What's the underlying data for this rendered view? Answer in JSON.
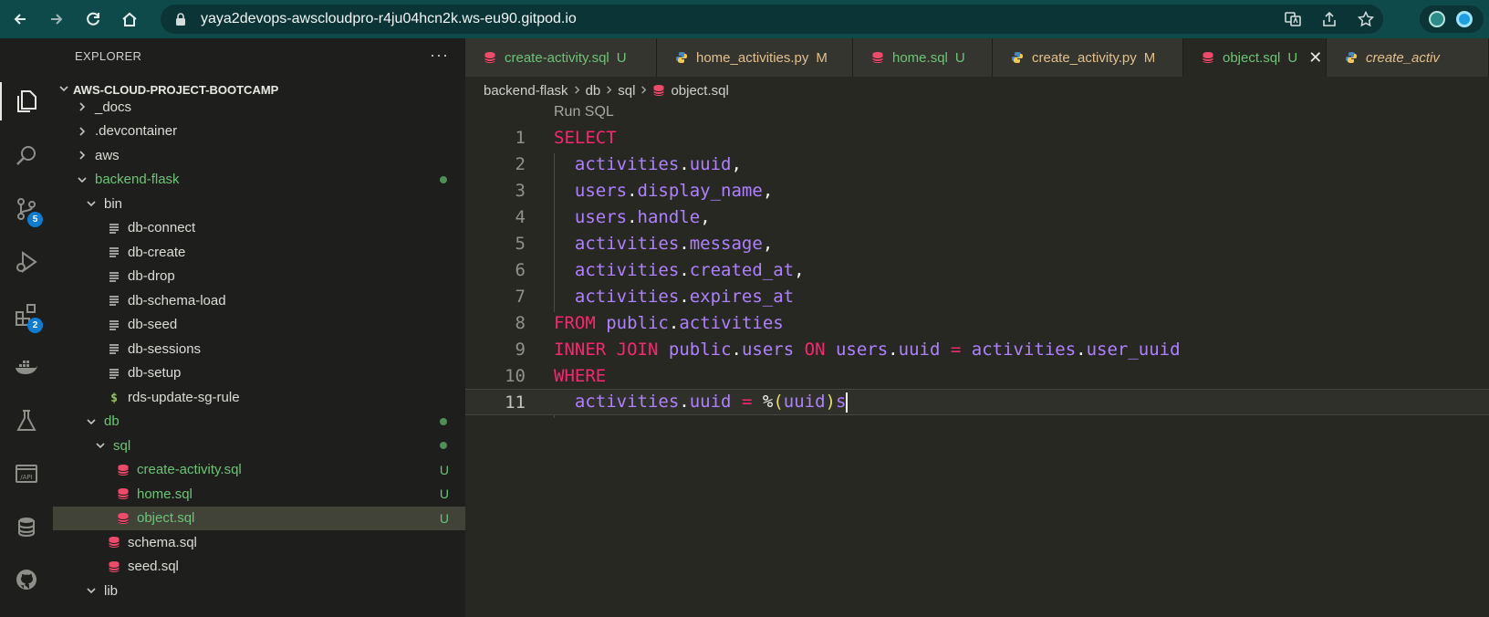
{
  "browser": {
    "url": "yaya2devops-awscloudpro-r4ju04hcn2k.ws-eu90.gitpod.io"
  },
  "activity_bar": {
    "items": [
      {
        "icon": "explorer-icon",
        "active": true
      },
      {
        "icon": "search-icon"
      },
      {
        "icon": "source-control-icon",
        "badge": "5"
      },
      {
        "icon": "run-debug-icon"
      },
      {
        "icon": "extensions-icon",
        "badge": "2"
      },
      {
        "icon": "docker-icon"
      },
      {
        "icon": "testing-icon"
      },
      {
        "icon": "api-icon"
      },
      {
        "icon": "database-icon"
      },
      {
        "icon": "github-icon"
      }
    ]
  },
  "sidebar": {
    "title": "EXPLORER",
    "more": "···",
    "root": "AWS-CLOUD-PROJECT-BOOTCAMP",
    "items": [
      {
        "label": "_docs",
        "depth": 0,
        "type": "folder",
        "open": false
      },
      {
        "label": ".devcontainer",
        "depth": 0,
        "type": "folder",
        "open": false
      },
      {
        "label": "aws",
        "depth": 0,
        "type": "folder",
        "open": false
      },
      {
        "label": "backend-flask",
        "depth": 0,
        "type": "folder",
        "open": true,
        "modified": true
      },
      {
        "label": "bin",
        "depth": 1,
        "type": "folder",
        "open": true
      },
      {
        "label": "db-connect",
        "depth": 2,
        "type": "script"
      },
      {
        "label": "db-create",
        "depth": 2,
        "type": "script"
      },
      {
        "label": "db-drop",
        "depth": 2,
        "type": "script"
      },
      {
        "label": "db-schema-load",
        "depth": 2,
        "type": "script"
      },
      {
        "label": "db-seed",
        "depth": 2,
        "type": "script"
      },
      {
        "label": "db-sessions",
        "depth": 2,
        "type": "script"
      },
      {
        "label": "db-setup",
        "depth": 2,
        "type": "script"
      },
      {
        "label": "rds-update-sg-rule",
        "depth": 2,
        "type": "shell"
      },
      {
        "label": "db",
        "depth": 1,
        "type": "folder",
        "open": true,
        "modified": true
      },
      {
        "label": "sql",
        "depth": 2,
        "type": "folder",
        "open": true,
        "modified": true
      },
      {
        "label": "create-activity.sql",
        "depth": 3,
        "type": "sql",
        "status": "U"
      },
      {
        "label": "home.sql",
        "depth": 3,
        "type": "sql",
        "status": "U"
      },
      {
        "label": "object.sql",
        "depth": 3,
        "type": "sql",
        "status": "U",
        "selected": true
      },
      {
        "label": "schema.sql",
        "depth": 2,
        "type": "sql"
      },
      {
        "label": "seed.sql",
        "depth": 2,
        "type": "sql"
      },
      {
        "label": "lib",
        "depth": 1,
        "type": "folder",
        "open": true
      }
    ]
  },
  "tabs": [
    {
      "label": "create-activity.sql",
      "status": "U",
      "type": "sql"
    },
    {
      "label": "home_activities.py",
      "status": "M",
      "type": "py"
    },
    {
      "label": "home.sql",
      "status": "U",
      "type": "sql"
    },
    {
      "label": "create_activity.py",
      "status": "M",
      "type": "py"
    },
    {
      "label": "object.sql",
      "status": "U",
      "type": "sql",
      "active": true,
      "close": "✕"
    },
    {
      "label": "create_activ",
      "type": "py",
      "preview": true
    }
  ],
  "breadcrumb": [
    "backend-flask",
    "db",
    "sql",
    "object.sql"
  ],
  "editor": {
    "codelens": "Run SQL",
    "current_line": 11,
    "lines": [
      {
        "n": "1",
        "text": "SELECT"
      },
      {
        "n": "2",
        "text": "  activities.uuid,"
      },
      {
        "n": "3",
        "text": "  users.display_name,"
      },
      {
        "n": "4",
        "text": "  users.handle,"
      },
      {
        "n": "5",
        "text": "  activities.message,"
      },
      {
        "n": "6",
        "text": "  activities.created_at,"
      },
      {
        "n": "7",
        "text": "  activities.expires_at"
      },
      {
        "n": "8",
        "text": "FROM public.activities"
      },
      {
        "n": "9",
        "text": "INNER JOIN public.users ON users.uuid = activities.user_uuid"
      },
      {
        "n": "10",
        "text": "WHERE"
      },
      {
        "n": "11",
        "text": "  activities.uuid = %(uuid)s"
      }
    ]
  },
  "colors": {
    "browser_bar": "#0f4a4b",
    "editor_bg": "#272822",
    "keyword": "#f92672",
    "identifier": "#ae81ff",
    "git_untracked": "#6cc477",
    "git_modified": "#e2c08d"
  }
}
